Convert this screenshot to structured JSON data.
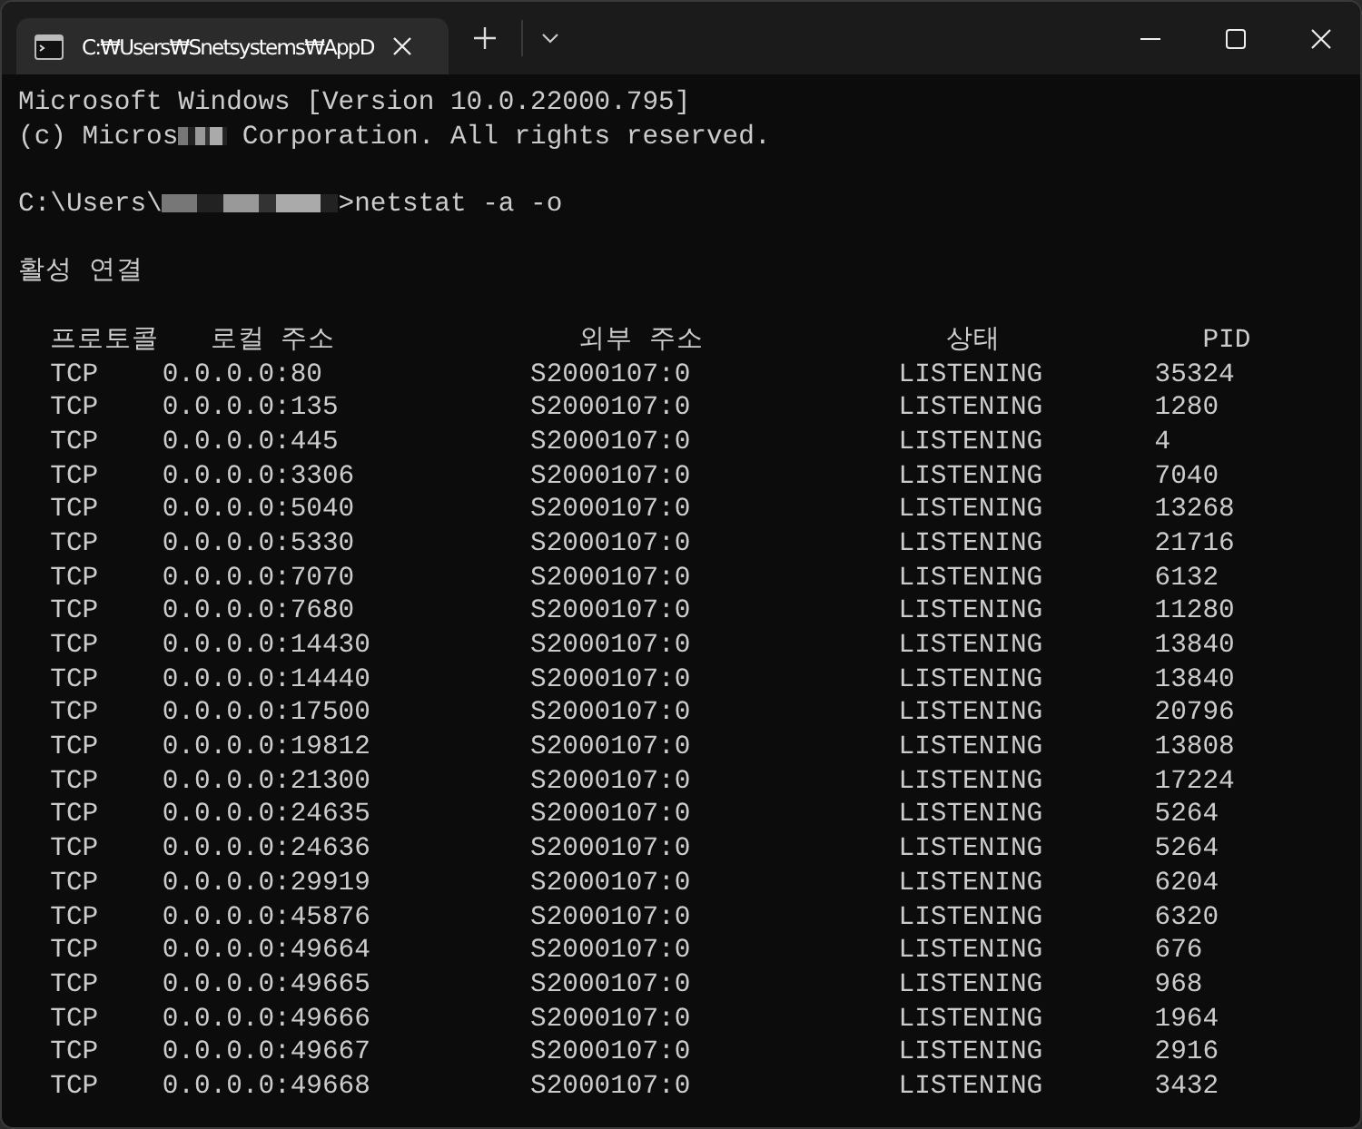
{
  "window": {
    "tab_title": "C:₩Users₩Snetsystems₩AppD"
  },
  "console": {
    "lines": [
      {
        "kind": "text",
        "text": "Microsoft Windows [Version 10.0.22000.795]"
      },
      {
        "kind": "redacted",
        "before": "(c) Micros",
        "after": " Corporation. All rights reserved."
      },
      {
        "kind": "blank"
      },
      {
        "kind": "redacted",
        "before": "C:\\Users\\",
        "after": ">netstat -a -o"
      },
      {
        "kind": "blank"
      },
      {
        "kind": "text",
        "text": "활성 연결"
      },
      {
        "kind": "blank"
      }
    ],
    "table": {
      "columns": [
        "프로토콜",
        "로컬 주소",
        "외부 주소",
        "상태",
        "PID"
      ],
      "rows": [
        [
          "TCP",
          "0.0.0.0:80",
          "S2000107:0",
          "LISTENING",
          "35324"
        ],
        [
          "TCP",
          "0.0.0.0:135",
          "S2000107:0",
          "LISTENING",
          "1280"
        ],
        [
          "TCP",
          "0.0.0.0:445",
          "S2000107:0",
          "LISTENING",
          "4"
        ],
        [
          "TCP",
          "0.0.0.0:3306",
          "S2000107:0",
          "LISTENING",
          "7040"
        ],
        [
          "TCP",
          "0.0.0.0:5040",
          "S2000107:0",
          "LISTENING",
          "13268"
        ],
        [
          "TCP",
          "0.0.0.0:5330",
          "S2000107:0",
          "LISTENING",
          "21716"
        ],
        [
          "TCP",
          "0.0.0.0:7070",
          "S2000107:0",
          "LISTENING",
          "6132"
        ],
        [
          "TCP",
          "0.0.0.0:7680",
          "S2000107:0",
          "LISTENING",
          "11280"
        ],
        [
          "TCP",
          "0.0.0.0:14430",
          "S2000107:0",
          "LISTENING",
          "13840"
        ],
        [
          "TCP",
          "0.0.0.0:14440",
          "S2000107:0",
          "LISTENING",
          "13840"
        ],
        [
          "TCP",
          "0.0.0.0:17500",
          "S2000107:0",
          "LISTENING",
          "20796"
        ],
        [
          "TCP",
          "0.0.0.0:19812",
          "S2000107:0",
          "LISTENING",
          "13808"
        ],
        [
          "TCP",
          "0.0.0.0:21300",
          "S2000107:0",
          "LISTENING",
          "17224"
        ],
        [
          "TCP",
          "0.0.0.0:24635",
          "S2000107:0",
          "LISTENING",
          "5264"
        ],
        [
          "TCP",
          "0.0.0.0:24636",
          "S2000107:0",
          "LISTENING",
          "5264"
        ],
        [
          "TCP",
          "0.0.0.0:29919",
          "S2000107:0",
          "LISTENING",
          "6204"
        ],
        [
          "TCP",
          "0.0.0.0:45876",
          "S2000107:0",
          "LISTENING",
          "6320"
        ],
        [
          "TCP",
          "0.0.0.0:49664",
          "S2000107:0",
          "LISTENING",
          "676"
        ],
        [
          "TCP",
          "0.0.0.0:49665",
          "S2000107:0",
          "LISTENING",
          "968"
        ],
        [
          "TCP",
          "0.0.0.0:49666",
          "S2000107:0",
          "LISTENING",
          "1964"
        ],
        [
          "TCP",
          "0.0.0.0:49667",
          "S2000107:0",
          "LISTENING",
          "2916"
        ],
        [
          "TCP",
          "0.0.0.0:49668",
          "S2000107:0",
          "LISTENING",
          "3432"
        ]
      ]
    }
  }
}
